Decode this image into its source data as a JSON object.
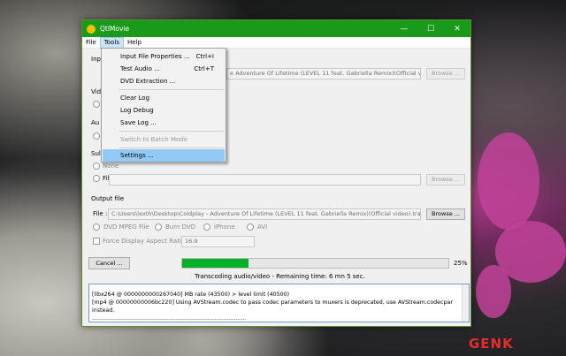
{
  "window": {
    "title": "QtlMovie",
    "controls": {
      "minimize": "—",
      "maximize": "☐",
      "close": "✕"
    }
  },
  "menubar": {
    "file": "File",
    "tools": "Tools",
    "help": "Help"
  },
  "tools_menu": {
    "items": [
      {
        "label": "Input File Properties ...",
        "shortcut": "Ctrl+I"
      },
      {
        "label": "Test Audio ...",
        "shortcut": "Ctrl+T"
      },
      {
        "label": "DVD Extraction ...",
        "shortcut": ""
      },
      {
        "label": "Clear Log",
        "shortcut": ""
      },
      {
        "label": "Log Debug",
        "shortcut": ""
      },
      {
        "label": "Save Log ...",
        "shortcut": ""
      },
      {
        "label": "Switch to Batch Mode",
        "shortcut": ""
      },
      {
        "label": "Settings ...",
        "shortcut": ""
      }
    ]
  },
  "input": {
    "label_partial": "Inp",
    "file_value_tail": "e Adventure Of Lifetime (LEVEL 11 feat. Gabriella Remix)(Official video).mp4",
    "browse": "Browse ..."
  },
  "sections": {
    "video_partial": "Vid",
    "audio_partial": "Au",
    "subtitles_partial": "Sul"
  },
  "subtitles": {
    "none_label": "None",
    "file_label": "File :",
    "browse": "Browse ..."
  },
  "output": {
    "label": "Output file",
    "file_label": "File :",
    "file_value": "C:\\Users\\lexth\\Desktop\\Coldplay - Adventure Of Lifetime (LEVEL 11 feat. Gabriella Remix)(Official video).transcoded.m",
    "browse": "Browse ...",
    "options": [
      "DVD MPEG File",
      "Burn DVD",
      "iPhone",
      "AVI"
    ],
    "force_aspect_label": "Force Display Aspect Ratio :",
    "aspect_value": "16:9"
  },
  "progress": {
    "cancel": "Cancel ...",
    "percent_label": "25%",
    "percent_value": 25,
    "status": "Transcoding audio/video - Remaining time: 6 mn 5 sec."
  },
  "log": {
    "lines": [
      "[libx264 @ 0000000000267040] MB rate (43500) > level limit (40500)",
      "[mp4 @ 00000000006bc220] Using AVStream.codec to pass codec parameters to muxers is deprecated, use AVStream.codecpar instead.",
      "......................................................................................."
    ]
  },
  "watermark": "GENK",
  "colors": {
    "titlebar": "#1a9a1a",
    "progress": "#06b025",
    "menu_highlight": "#91c9f7"
  }
}
